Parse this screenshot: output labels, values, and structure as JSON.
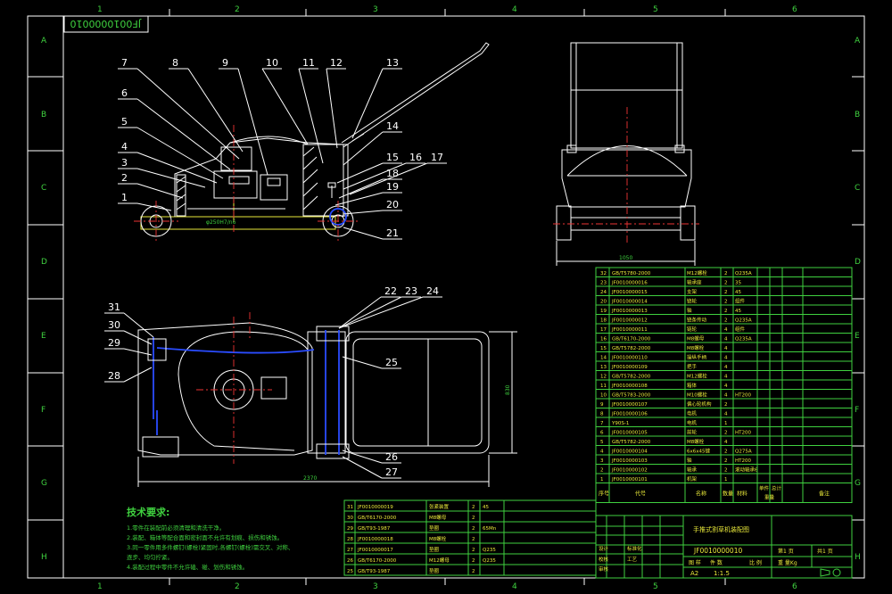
{
  "drawing_number": "JF0010000010",
  "grid": {
    "columns": [
      "1",
      "2",
      "3",
      "4",
      "5",
      "6"
    ],
    "rows": [
      "A",
      "B",
      "C",
      "D",
      "E",
      "F",
      "G",
      "H"
    ]
  },
  "side_view_balloons": [
    "1",
    "2",
    "3",
    "4",
    "5",
    "6",
    "7",
    "8",
    "9",
    "10",
    "11",
    "12",
    "13",
    "14",
    "15",
    "16",
    "17",
    "18",
    "19",
    "20",
    "21"
  ],
  "top_view_balloons": [
    "22",
    "23",
    "24",
    "25",
    "26",
    "27",
    "28",
    "29",
    "30",
    "31"
  ],
  "dimensions": {
    "side": "φ250H7/n6",
    "front_width": "1050",
    "top_length": "2370",
    "top_height": "830"
  },
  "tech_requirements": {
    "title": "技术要求:",
    "lines": [
      "1.零件在装配前必须清理和清洗干净。",
      "2.装配、箱体等配合面和密封面不允许有划痕、损伤和锈蚀。",
      "3.同一零件用多件螺钉(螺栓)紧固时,各螺钉(螺栓)需交叉、对称、",
      "逐步、均匀拧紧。",
      "4.装配过程中零件不允许磕、碰、划伤和锈蚀。"
    ]
  },
  "bom_right": [
    {
      "no": "32",
      "code": "GB/T5780-2000",
      "name": "M12螺栓",
      "qty": "2",
      "mat": "Q235A"
    },
    {
      "no": "23",
      "code": "JF0010000016",
      "name": "轴承座",
      "qty": "2",
      "mat": "35"
    },
    {
      "no": "24",
      "code": "JF0010000015",
      "name": "支架",
      "qty": "2",
      "mat": "45"
    },
    {
      "no": "20",
      "code": "JF0010000014",
      "name": "链轮",
      "qty": "2",
      "mat": "组件"
    },
    {
      "no": "19",
      "code": "JF0010000013",
      "name": "轴",
      "qty": "2",
      "mat": "45"
    },
    {
      "no": "18",
      "code": "JF0010000012",
      "name": "链条传动",
      "qty": "2",
      "mat": "Q235A"
    },
    {
      "no": "17",
      "code": "JF0010000011",
      "name": "链轮",
      "qty": "4",
      "mat": "组件"
    },
    {
      "no": "16",
      "code": "GB/T6170-2000",
      "name": "M8螺母",
      "qty": "4",
      "mat": "Q235A"
    },
    {
      "no": "15",
      "code": "GB/T5782-2000",
      "name": "M8螺栓",
      "qty": "4",
      "mat": ""
    },
    {
      "no": "14",
      "code": "JF0010000110",
      "name": "操纵手柄",
      "qty": "4",
      "mat": ""
    },
    {
      "no": "13",
      "code": "JF0010000109",
      "name": "把手",
      "qty": "4",
      "mat": ""
    },
    {
      "no": "12",
      "code": "GB/T5782-2000",
      "name": "M12螺栓",
      "qty": "4",
      "mat": ""
    },
    {
      "no": "11",
      "code": "JF0010000108",
      "name": "箱体",
      "qty": "4",
      "mat": ""
    },
    {
      "no": "10",
      "code": "GB/T5783-2000",
      "name": "M10螺栓",
      "qty": "4",
      "mat": "HT200"
    },
    {
      "no": "9",
      "code": "JF0010000107",
      "name": "偏心轮机构",
      "qty": "2",
      "mat": ""
    },
    {
      "no": "8",
      "code": "JF0010000106",
      "name": "电机",
      "qty": "4",
      "mat": ""
    },
    {
      "no": "7",
      "code": "Y90S-1",
      "name": "电机",
      "qty": "1",
      "mat": ""
    },
    {
      "no": "6",
      "code": "JF0010000105",
      "name": "前轮",
      "qty": "2",
      "mat": "HT200"
    },
    {
      "no": "5",
      "code": "GB/T5782-2000",
      "name": "M8螺栓",
      "qty": "4",
      "mat": ""
    },
    {
      "no": "4",
      "code": "JF0010000104",
      "name": "6x6x45键",
      "qty": "2",
      "mat": "Q275A"
    },
    {
      "no": "3",
      "code": "JF0010000103",
      "name": "轴",
      "qty": "2",
      "mat": "HT200"
    },
    {
      "no": "2",
      "code": "JF0010000102",
      "name": "轴承",
      "qty": "2",
      "mat": "滚动轴承6"
    },
    {
      "no": "1",
      "code": "JF0010000101",
      "name": "机架",
      "qty": "1",
      "mat": ""
    }
  ],
  "bom_header": {
    "no": "序号",
    "code": "代号",
    "name": "名称",
    "qty": "数量",
    "mat": "材料",
    "unit": "单件",
    "total": "总计",
    "weight": "重量",
    "remark": "备注"
  },
  "bom_bottom": [
    {
      "no": "31",
      "code": "JF0010000019",
      "name": "张紧装置",
      "qty": "2",
      "mat": "45"
    },
    {
      "no": "30",
      "code": "GB/T6170-2000",
      "name": "M8螺母",
      "qty": "2",
      "mat": ""
    },
    {
      "no": "29",
      "code": "GB/T93-1987",
      "name": "垫圈",
      "qty": "2",
      "mat": "65Mn"
    },
    {
      "no": "28",
      "code": "JF0010000018",
      "name": "M8螺栓",
      "qty": "2",
      "mat": ""
    },
    {
      "no": "27",
      "code": "JF0010000017",
      "name": "垫圈",
      "qty": "2",
      "mat": "Q235"
    },
    {
      "no": "26",
      "code": "GB/T6170-2000",
      "name": "M12螺母",
      "qty": "2",
      "mat": "Q235"
    },
    {
      "no": "25",
      "code": "GB/T93-1987",
      "name": "垫圈",
      "qty": "2",
      "mat": ""
    }
  ],
  "title_block": {
    "product": "手推式割草机装配图",
    "number": "JF0010000010",
    "size": "A2",
    "scale": "1:1.5",
    "sheet": "第1 页",
    "total": "共1 页",
    "drawing": "图 样",
    "scale_label": "比 例",
    "weight_label": "重 量Kg",
    "part_label": "件 数",
    "design": "设计",
    "check": "校核",
    "approve": "审核",
    "process": "工艺",
    "standard": "标准化"
  },
  "colors": {
    "frame": "#ffffff",
    "cad_green": "#3fd13f",
    "cad_yellow": "#e9e93a",
    "center_red": "#ee3333",
    "chain_blue": "#2a4cff",
    "background": "#000000"
  }
}
